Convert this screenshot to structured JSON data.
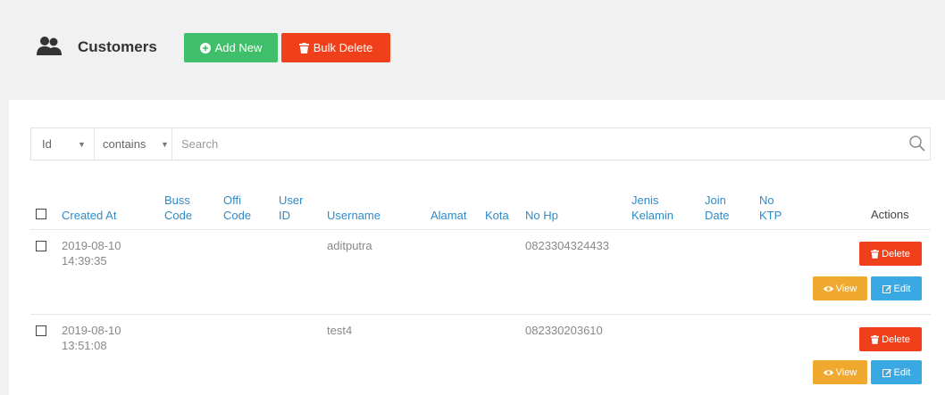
{
  "page": {
    "title": "Customers",
    "add_new_label": "Add New",
    "bulk_delete_label": "Bulk Delete"
  },
  "search": {
    "field_value": "Id",
    "operator_value": "contains",
    "placeholder": "Search"
  },
  "table": {
    "headers": {
      "created_at": "Created At",
      "buss_code_1": "Buss",
      "buss_code_2": "Code",
      "offi_code_1": "Offi",
      "offi_code_2": "Code",
      "user_id_1": "User",
      "user_id_2": "ID",
      "username": "Username",
      "alamat": "Alamat",
      "kota": "Kota",
      "no_hp": "No Hp",
      "jenis_kelamin_1": "Jenis",
      "jenis_kelamin_2": "Kelamin",
      "join_date_1": "Join",
      "join_date_2": "Date",
      "no_ktp_1": "No",
      "no_ktp_2": "KTP",
      "actions": "Actions"
    },
    "rows": [
      {
        "created_date": "2019-08-10",
        "created_time": "14:39:35",
        "username": "aditputra",
        "no_hp": "0823304324433"
      },
      {
        "created_date": "2019-08-10",
        "created_time": "13:51:08",
        "username": "test4",
        "no_hp": "082330203610"
      }
    ],
    "row_actions": {
      "delete_label": "Delete",
      "view_label": "View",
      "edit_label": "Edit"
    }
  },
  "colors": {
    "add_new": "#3fbf6a",
    "delete": "#f0401b",
    "view": "#f0a92e",
    "edit": "#3aa8e2",
    "header_link": "#2e8bc9"
  }
}
